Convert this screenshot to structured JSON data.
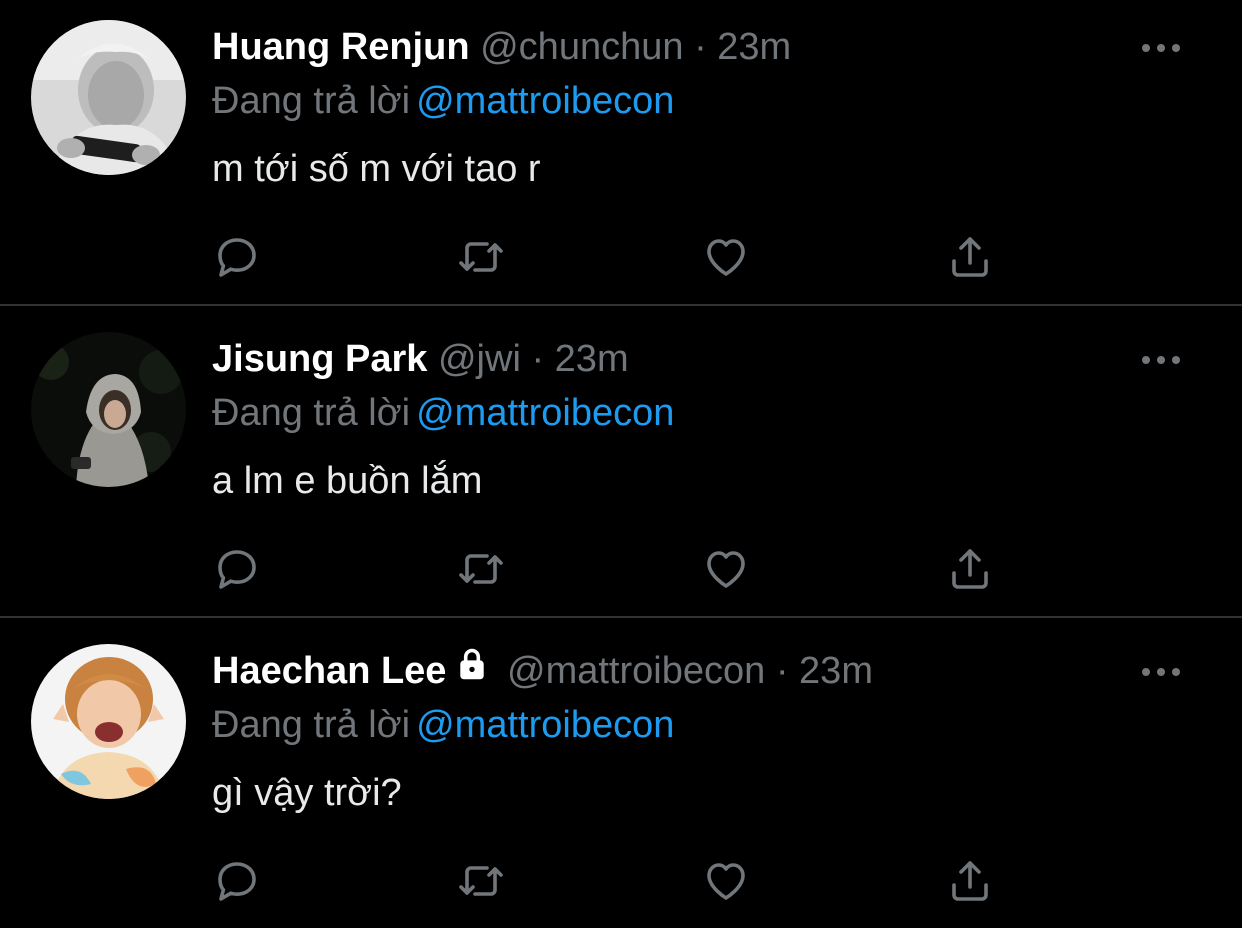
{
  "tweets": [
    {
      "name": "Huang Renjun",
      "handle": "@chunchun",
      "separator": "·",
      "time": "23m",
      "replying_prefix": "Đang trả lời",
      "replying_to": "@mattroibecon",
      "text": "m tới số m với tao r",
      "locked": false,
      "avatar_style": "grayscale-photo"
    },
    {
      "name": "Jisung Park",
      "handle": "@jwi",
      "separator": "·",
      "time": "23m",
      "replying_prefix": "Đang trả lời",
      "replying_to": "@mattroibecon",
      "text": "a lm e buồn lắm",
      "locked": false,
      "avatar_style": "dark-night-hoodie-photo"
    },
    {
      "name": "Haechan Lee",
      "handle": "@mattroibecon",
      "separator": "·",
      "time": "23m",
      "replying_prefix": "Đang trả lời",
      "replying_to": "@mattroibecon",
      "text": "gì vậy trời?",
      "locked": true,
      "avatar_style": "bright-colorful-photo"
    }
  ],
  "icons": {
    "reply": "reply-icon",
    "retweet": "retweet-icon",
    "like": "heart-icon",
    "share": "share-icon",
    "more": "more-icon",
    "lock": "lock-icon"
  },
  "colors": {
    "background": "#000000",
    "name": "#ffffff",
    "secondary_text": "#71767b",
    "mention": "#1d9bf0",
    "body_text": "#e7e9ea",
    "divider": "#2f3336"
  }
}
